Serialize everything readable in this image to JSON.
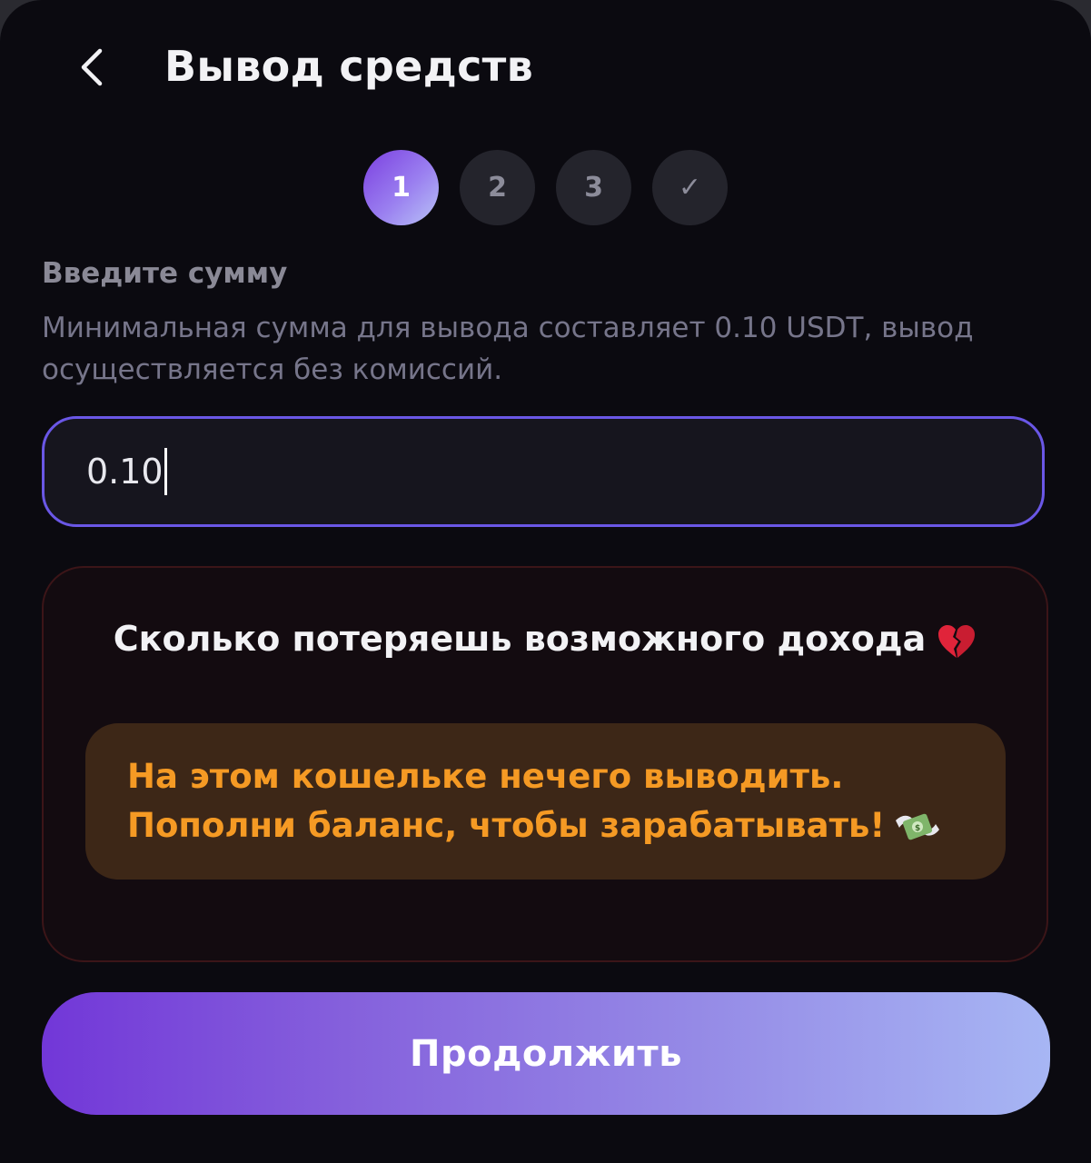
{
  "header": {
    "back_icon": "chevron-left-icon",
    "title": "Вывод средств"
  },
  "stepper": {
    "steps": [
      "1",
      "2",
      "3",
      "✓"
    ],
    "active_step": 1
  },
  "amount": {
    "label": "Введите сумму",
    "hint": "Минимальная сумма для вывода составляет 0.10 USDT, вывод осуществляется без комиссий.",
    "value": "0.10"
  },
  "loss_card": {
    "title": "Сколько потеряешь возможного дохода",
    "title_icon": "broken-heart-icon",
    "notice_line1": "На этом кошельке нечего выводить.",
    "notice_line2": "Пополни баланс, чтобы зарабатывать!",
    "notice_icon": "money-with-wings-icon"
  },
  "actions": {
    "continue_label": "Продолжить"
  },
  "colors": {
    "background": "#0b0a10",
    "accent_start": "#7237d8",
    "accent_end": "#a7b6f4",
    "input_border": "#6a57e6",
    "warning_text": "#f59a24",
    "warning_bg": "#3d2717"
  }
}
